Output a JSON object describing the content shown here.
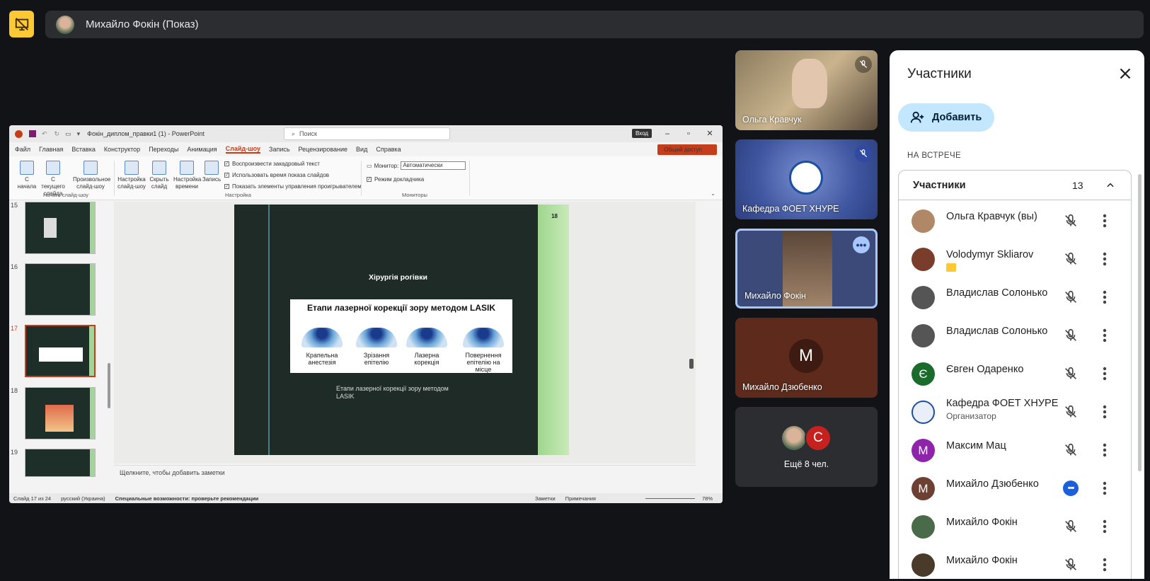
{
  "top": {
    "presenter_title": "Михайло Фокін (Показ)"
  },
  "ppt": {
    "file_title": "Фокін_диплом_правки1 (1)  -  PowerPoint",
    "search_placeholder": "Поиск",
    "login": "Вход",
    "tabs": [
      "Файл",
      "Главная",
      "Вставка",
      "Конструктор",
      "Переходы",
      "Анимация",
      "Слайд-шоу",
      "Запись",
      "Рецензирование",
      "Вид",
      "Справка"
    ],
    "active_tab": "Слайд-шоу",
    "share": "Общий доступ",
    "ribbon": {
      "btn_start": "С начала",
      "btn_current": "С текущего слайда",
      "btn_custom": "Произвольное слайд-шоу",
      "btn_setup": "Настройка слайд-шоу",
      "btn_hide": "Скрыть слайд",
      "btn_timings": "Настройка времени",
      "btn_record": "Запись",
      "chk_narration": "Воспроизвести закадровый текст",
      "chk_timings": "Использовать время показа слайдов",
      "chk_controls": "Показать элементы управления проигрывателем",
      "monitor_label": "Монитор:",
      "monitor_value": "Автоматически",
      "chk_presenter": "Режим докладчика",
      "grp_start": "Начать слайд-шоу",
      "grp_setup": "Настройка",
      "grp_monitors": "Мониторы"
    },
    "thumb_numbers": [
      "15",
      "16",
      "17",
      "18",
      "19"
    ],
    "slide": {
      "number": "18",
      "heading": "Хірургія рогівки",
      "image_title": "Етапи лазерної корекції зору методом LASIK",
      "steps": [
        "Крапельна анестезія",
        "Зрізання епітелію",
        "Лазерна корекція",
        "Повернення епітелію на місце"
      ],
      "caption": "Етапи лазерної корекції зору методом LASIK"
    },
    "notes_placeholder": "Щелкните, чтобы добавить заметки",
    "status": {
      "slide": "Слайд 17 из 24",
      "lang": "русский (Украина)",
      "accessibility": "Специальные возможности: проверьте рекомендации",
      "notes": "Заметки",
      "comments": "Примечания",
      "zoom": "78%"
    }
  },
  "tiles": {
    "t1": "Ольга Кравчук",
    "t2": "Кафедра ФОЕТ ХНУРЕ",
    "t3": "Михайло Фокін",
    "t4_initial": "M",
    "t4": "Михайло Дзюбенко",
    "t5_initial": "C",
    "t5": "Ещё 8 чел."
  },
  "panel": {
    "title": "Участники",
    "add": "Добавить",
    "section": "НА ВСТРЕЧЕ",
    "group": "Участники",
    "count": "13",
    "people": [
      {
        "name": "Ольга Кравчук (вы)",
        "initial": "",
        "color": "#b08868"
      },
      {
        "name": "Volodymyr Skliarov",
        "initial": "",
        "color": "#7a3d2c"
      },
      {
        "name": "Владислав Солонько",
        "initial": "",
        "color": "#555"
      },
      {
        "name": "Владислав Солонько",
        "initial": "",
        "color": "#555"
      },
      {
        "name": "Євген Одаренко",
        "initial": "Є",
        "color": "#1b6b2c"
      },
      {
        "name": "Кафедра ФОЕТ ХНУРЕ",
        "sub": "Организатор",
        "initial": "",
        "color": "#e9eef8"
      },
      {
        "name": "Максим Мац",
        "initial": "М",
        "color": "#8e24aa"
      },
      {
        "name": "Михайло Дзюбенко",
        "initial": "М",
        "color": "#6d4034"
      },
      {
        "name": "Михайло Фокін",
        "initial": "",
        "color": "#4a6b4a"
      },
      {
        "name": "Михайло Фокін",
        "initial": "",
        "color": "#4a3a2a"
      }
    ]
  }
}
